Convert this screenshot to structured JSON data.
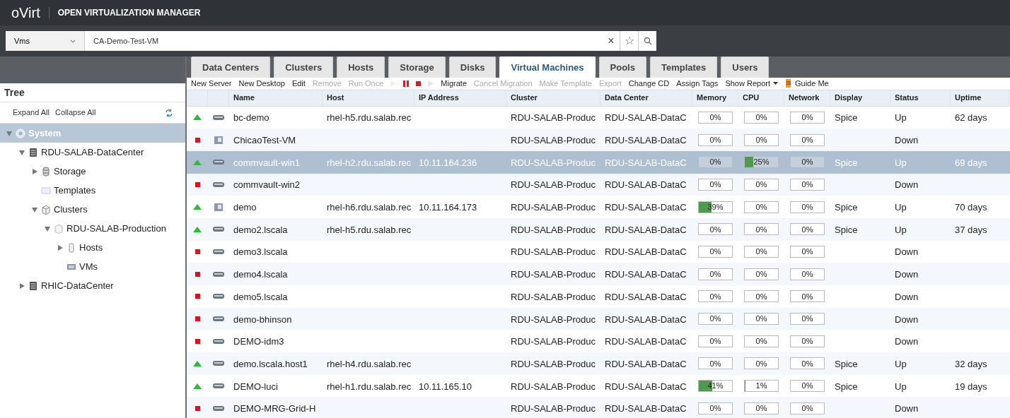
{
  "header": {
    "logo": "oVirt",
    "title": "OPEN VIRTUALIZATION MANAGER"
  },
  "search": {
    "scope": "Vms",
    "value": "CA-Demo-Test-VM",
    "clear": "×",
    "bookmark": "☆"
  },
  "tabs": [
    {
      "label": "Data Centers",
      "selected": false
    },
    {
      "label": "Clusters",
      "selected": false
    },
    {
      "label": "Hosts",
      "selected": false
    },
    {
      "label": "Storage",
      "selected": false
    },
    {
      "label": "Disks",
      "selected": false
    },
    {
      "label": "Virtual Machines",
      "selected": true
    },
    {
      "label": "Pools",
      "selected": false
    },
    {
      "label": "Templates",
      "selected": false
    },
    {
      "label": "Users",
      "selected": false
    }
  ],
  "tree": {
    "title": "Tree",
    "actions": [
      "Expand All",
      "Collapse All"
    ],
    "items": [
      {
        "label": "System",
        "kind": "system",
        "expanded": true,
        "selected": true,
        "children": [
          {
            "label": "RDU-SALAB-DataCenter",
            "kind": "datacenter",
            "expanded": true,
            "selected": false,
            "children": [
              {
                "label": "Storage",
                "kind": "storage",
                "expanded": false,
                "selected": false
              },
              {
                "label": "Templates",
                "kind": "templates",
                "selected": false
              },
              {
                "label": "Clusters",
                "kind": "clusters",
                "expanded": true,
                "selected": false,
                "children": [
                  {
                    "label": "RDU-SALAB-Production",
                    "kind": "cluster",
                    "expanded": true,
                    "selected": false,
                    "children": [
                      {
                        "label": "Hosts",
                        "kind": "hosts",
                        "expanded": false,
                        "selected": false
                      },
                      {
                        "label": "VMs",
                        "kind": "vms",
                        "selected": false
                      }
                    ]
                  }
                ]
              }
            ]
          },
          {
            "label": "RHIC-DataCenter",
            "kind": "datacenter",
            "expanded": false,
            "selected": false
          }
        ]
      }
    ]
  },
  "toolbar": [
    {
      "kind": "text",
      "label": "New Server",
      "disabled": false
    },
    {
      "kind": "text",
      "label": "New Desktop",
      "disabled": false
    },
    {
      "kind": "text",
      "label": "Edit",
      "disabled": false
    },
    {
      "kind": "text",
      "label": "Remove",
      "disabled": true
    },
    {
      "kind": "text",
      "label": "Run Once",
      "disabled": true
    },
    {
      "kind": "play",
      "disabled": true
    },
    {
      "kind": "pause",
      "disabled": false
    },
    {
      "kind": "stop",
      "disabled": false
    },
    {
      "kind": "power",
      "disabled": true
    },
    {
      "kind": "text",
      "label": "Migrate",
      "disabled": false
    },
    {
      "kind": "text",
      "label": "Cancel Migration",
      "disabled": true
    },
    {
      "kind": "text",
      "label": "Make Template",
      "disabled": true
    },
    {
      "kind": "text",
      "label": "Export",
      "disabled": true
    },
    {
      "kind": "text",
      "label": "Change CD",
      "disabled": false
    },
    {
      "kind": "text",
      "label": "Assign Tags",
      "disabled": false
    },
    {
      "kind": "menu",
      "label": "Show Report",
      "disabled": false
    },
    {
      "kind": "guide",
      "label": "Guide Me",
      "disabled": false
    }
  ],
  "table": {
    "columns": [
      "Name",
      "Host",
      "IP Address",
      "Cluster",
      "Data Center",
      "Memory",
      "CPU",
      "Network",
      "Display",
      "Status",
      "Uptime"
    ],
    "rows": [
      {
        "running": true,
        "kind": "server",
        "selected": false,
        "name": "bc-demo",
        "host": "rhel-h5.rdu.salab.rec",
        "ip": "",
        "cluster": "RDU-SALAB-Produc",
        "datacenter": "RDU-SALAB-DataC",
        "memory": {
          "reading": "0%",
          "level": 0
        },
        "cpu": {
          "reading": "0%",
          "level": 0
        },
        "network": {
          "reading": "0%",
          "level": 0
        },
        "display": "Spice",
        "status": "Up",
        "uptime": "62 days"
      },
      {
        "running": false,
        "kind": "desktop",
        "selected": false,
        "name": "ChicaoTest-VM",
        "host": "",
        "ip": "",
        "cluster": "RDU-SALAB-Produc",
        "datacenter": "RDU-SALAB-DataC",
        "memory": {
          "reading": "0%",
          "level": 0
        },
        "cpu": {
          "reading": "0%",
          "level": 0
        },
        "network": {
          "reading": "0%",
          "level": 0
        },
        "display": "",
        "status": "Down",
        "uptime": ""
      },
      {
        "running": true,
        "kind": "server",
        "selected": true,
        "name": "commvault-win1",
        "host": "rhel-h2.rdu.salab.rec",
        "ip": "10.11.164.236",
        "cluster": "RDU-SALAB-Produc",
        "datacenter": "RDU-SALAB-DataC",
        "memory": {
          "reading": "0%",
          "level": 0
        },
        "cpu": {
          "reading": "25%",
          "level": 0.25
        },
        "network": {
          "reading": "0%",
          "level": 0
        },
        "display": "Spice",
        "status": "Up",
        "uptime": "69 days"
      },
      {
        "running": false,
        "kind": "server",
        "selected": false,
        "name": "commvault-win2",
        "host": "",
        "ip": "",
        "cluster": "RDU-SALAB-Produc",
        "datacenter": "RDU-SALAB-DataC",
        "memory": {
          "reading": "0%",
          "level": 0
        },
        "cpu": {
          "reading": "0%",
          "level": 0
        },
        "network": {
          "reading": "0%",
          "level": 0
        },
        "display": "",
        "status": "Down",
        "uptime": ""
      },
      {
        "running": true,
        "kind": "desktop",
        "selected": false,
        "name": "demo",
        "host": "rhel-h6.rdu.salab.rec",
        "ip": "10.11.164.173",
        "cluster": "RDU-SALAB-Produc",
        "datacenter": "RDU-SALAB-DataC",
        "memory": {
          "reading": "39%",
          "level": 0.39
        },
        "cpu": {
          "reading": "0%",
          "level": 0
        },
        "network": {
          "reading": "0%",
          "level": 0
        },
        "display": "Spice",
        "status": "Up",
        "uptime": "70 days"
      },
      {
        "running": true,
        "kind": "server",
        "selected": false,
        "name": "demo2.lscala",
        "host": "rhel-h5.rdu.salab.rec",
        "ip": "",
        "cluster": "RDU-SALAB-Produc",
        "datacenter": "RDU-SALAB-DataC",
        "memory": {
          "reading": "0%",
          "level": 0
        },
        "cpu": {
          "reading": "0%",
          "level": 0
        },
        "network": {
          "reading": "0%",
          "level": 0
        },
        "display": "Spice",
        "status": "Up",
        "uptime": "37 days"
      },
      {
        "running": false,
        "kind": "server",
        "selected": false,
        "name": "demo3.lscala",
        "host": "",
        "ip": "",
        "cluster": "RDU-SALAB-Produc",
        "datacenter": "RDU-SALAB-DataC",
        "memory": {
          "reading": "0%",
          "level": 0
        },
        "cpu": {
          "reading": "0%",
          "level": 0
        },
        "network": {
          "reading": "0%",
          "level": 0
        },
        "display": "",
        "status": "Down",
        "uptime": ""
      },
      {
        "running": false,
        "kind": "server",
        "selected": false,
        "name": "demo4.lscala",
        "host": "",
        "ip": "",
        "cluster": "RDU-SALAB-Produc",
        "datacenter": "RDU-SALAB-DataC",
        "memory": {
          "reading": "0%",
          "level": 0
        },
        "cpu": {
          "reading": "0%",
          "level": 0
        },
        "network": {
          "reading": "0%",
          "level": 0
        },
        "display": "",
        "status": "Down",
        "uptime": ""
      },
      {
        "running": false,
        "kind": "server",
        "selected": false,
        "name": "demo5.lscala",
        "host": "",
        "ip": "",
        "cluster": "RDU-SALAB-Produc",
        "datacenter": "RDU-SALAB-DataC",
        "memory": {
          "reading": "0%",
          "level": 0
        },
        "cpu": {
          "reading": "0%",
          "level": 0
        },
        "network": {
          "reading": "0%",
          "level": 0
        },
        "display": "",
        "status": "Down",
        "uptime": ""
      },
      {
        "running": false,
        "kind": "server",
        "selected": false,
        "name": "demo-bhinson",
        "host": "",
        "ip": "",
        "cluster": "RDU-SALAB-Produc",
        "datacenter": "RDU-SALAB-DataC",
        "memory": {
          "reading": "0%",
          "level": 0
        },
        "cpu": {
          "reading": "0%",
          "level": 0
        },
        "network": {
          "reading": "0%",
          "level": 0
        },
        "display": "",
        "status": "Down",
        "uptime": ""
      },
      {
        "running": false,
        "kind": "server",
        "selected": false,
        "name": "DEMO-idm3",
        "host": "",
        "ip": "",
        "cluster": "RDU-SALAB-Produc",
        "datacenter": "RDU-SALAB-DataC",
        "memory": {
          "reading": "0%",
          "level": 0
        },
        "cpu": {
          "reading": "0%",
          "level": 0
        },
        "network": {
          "reading": "0%",
          "level": 0
        },
        "display": "",
        "status": "Down",
        "uptime": ""
      },
      {
        "running": true,
        "kind": "server",
        "selected": false,
        "name": "demo.lscala.host1",
        "host": "rhel-h4.rdu.salab.rec",
        "ip": "",
        "cluster": "RDU-SALAB-Produc",
        "datacenter": "RDU-SALAB-DataC",
        "memory": {
          "reading": "0%",
          "level": 0
        },
        "cpu": {
          "reading": "0%",
          "level": 0
        },
        "network": {
          "reading": "0%",
          "level": 0
        },
        "display": "Spice",
        "status": "Up",
        "uptime": "32 days"
      },
      {
        "running": true,
        "kind": "server",
        "selected": false,
        "name": "DEMO-luci",
        "host": "rhel-h1.rdu.salab.rec",
        "ip": "10.11.165.10",
        "cluster": "RDU-SALAB-Produc",
        "datacenter": "RDU-SALAB-DataC",
        "memory": {
          "reading": "41%",
          "level": 0.41
        },
        "cpu": {
          "reading": "1%",
          "level": 0.01
        },
        "network": {
          "reading": "0%",
          "level": 0
        },
        "display": "Spice",
        "status": "Up",
        "uptime": "19 days"
      },
      {
        "running": false,
        "kind": "server",
        "selected": false,
        "name": "DEMO-MRG-Grid-H",
        "host": "",
        "ip": "",
        "cluster": "RDU-SALAB-Produc",
        "datacenter": "RDU-SALAB-DataC",
        "memory": {
          "reading": "0%",
          "level": 0
        },
        "cpu": {
          "reading": "0%",
          "level": 0
        },
        "network": {
          "reading": "0%",
          "level": 0
        },
        "display": "",
        "status": "Down",
        "uptime": ""
      }
    ]
  }
}
